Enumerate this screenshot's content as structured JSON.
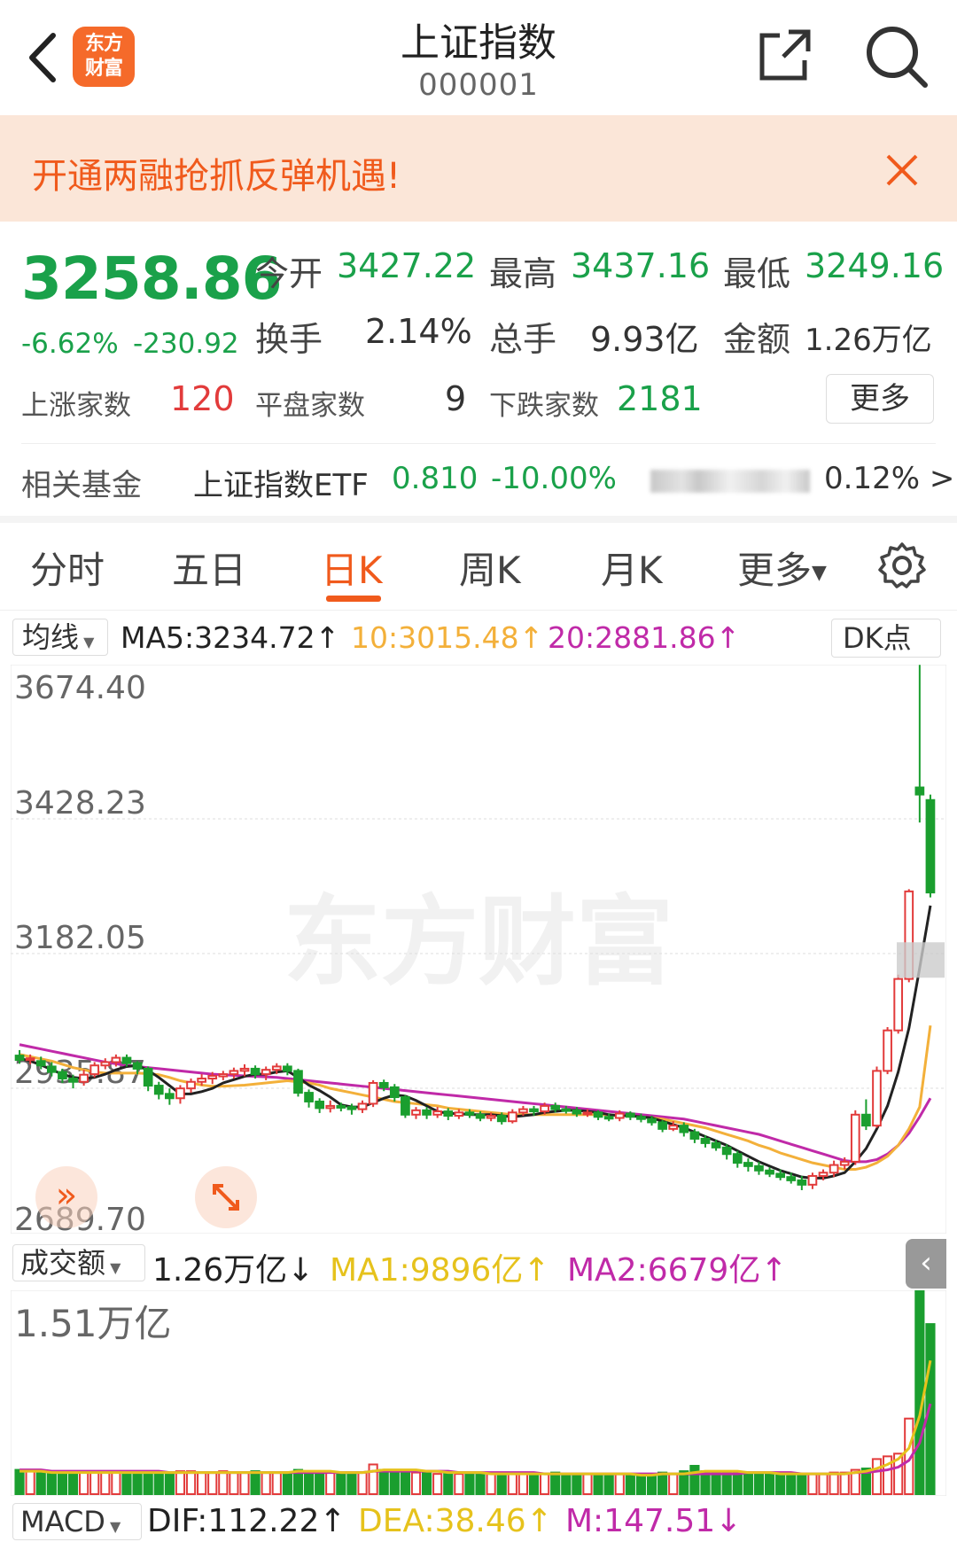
{
  "header": {
    "title": "上证指数",
    "code": "000001",
    "logo_text_line1": "东方",
    "logo_text_line2": "财富"
  },
  "banner": {
    "text": "开通两融抢抓反弹机遇!"
  },
  "quote": {
    "price": "3258.86",
    "change_pct": "-6.62%",
    "change": "-230.92",
    "open_label": "今开",
    "open": "3427.22",
    "high_label": "最高",
    "high": "3437.16",
    "low_label": "最低",
    "low": "3249.16",
    "turnover_label": "换手",
    "turnover": "2.14%",
    "volume_label": "总手",
    "volume": "9.93亿",
    "amount_label": "金额",
    "amount": "1.26万亿",
    "up_label": "上涨家数",
    "up": "120",
    "flat_label": "平盘家数",
    "flat": "9",
    "down_label": "下跌家数",
    "down": "2181",
    "more": "更多"
  },
  "fund": {
    "label": "相关基金",
    "name": "上证指数ETF",
    "price": "0.810",
    "change_pct": "-10.00%",
    "extra": "0.12% >"
  },
  "tabs": [
    "分时",
    "五日",
    "日K",
    "周K",
    "月K",
    "更多"
  ],
  "active_tab": "日K",
  "ma_row": {
    "selector": "均线",
    "ma5": "MA5:3234.72↑",
    "ma10": "10:3015.48↑",
    "ma20": "20:2881.86↑",
    "dk": "DK点"
  },
  "main_chart": {
    "ticks": [
      "3674.40",
      "3428.23",
      "3182.05",
      "2935.87",
      "2689.70"
    ],
    "watermark": "东方财富"
  },
  "volume_row": {
    "selector": "成交额",
    "value": "1.26万亿↓",
    "ma1": "MA1:9896亿↑",
    "ma2": "MA2:6679亿↑"
  },
  "volume_chart": {
    "top_tick": "1.51万亿"
  },
  "macd_row": {
    "selector": "MACD",
    "dif": "DIF:112.22↑",
    "dea": "DEA:38.46↑",
    "m": "M:147.51↓"
  },
  "chart_data": {
    "type": "candlestick",
    "ylim": [
      2689.7,
      3674.4
    ],
    "candles": [
      [
        2960,
        2952,
        2970,
        2945
      ],
      [
        2952,
        2955,
        2962,
        2944
      ],
      [
        2950,
        2942,
        2958,
        2935
      ],
      [
        2940,
        2930,
        2948,
        2922
      ],
      [
        2930,
        2918,
        2936,
        2910
      ],
      [
        2918,
        2912,
        2925,
        2900
      ],
      [
        2912,
        2925,
        2934,
        2905
      ],
      [
        2926,
        2942,
        2948,
        2920
      ],
      [
        2942,
        2948,
        2955,
        2935
      ],
      [
        2948,
        2956,
        2962,
        2940
      ],
      [
        2956,
        2946,
        2962,
        2940
      ],
      [
        2946,
        2936,
        2950,
        2926
      ],
      [
        2936,
        2905,
        2940,
        2895
      ],
      [
        2905,
        2890,
        2912,
        2880
      ],
      [
        2890,
        2882,
        2900,
        2870
      ],
      [
        2882,
        2900,
        2906,
        2872
      ],
      [
        2900,
        2912,
        2918,
        2892
      ],
      [
        2912,
        2918,
        2926,
        2905
      ],
      [
        2918,
        2923,
        2930,
        2908
      ],
      [
        2922,
        2926,
        2932,
        2915
      ],
      [
        2926,
        2932,
        2938,
        2918
      ],
      [
        2932,
        2936,
        2944,
        2922
      ],
      [
        2936,
        2926,
        2942,
        2918
      ],
      [
        2926,
        2934,
        2940,
        2915
      ],
      [
        2934,
        2940,
        2946,
        2926
      ],
      [
        2940,
        2932,
        2946,
        2924
      ],
      [
        2932,
        2892,
        2936,
        2885
      ],
      [
        2892,
        2876,
        2898,
        2865
      ],
      [
        2876,
        2864,
        2882,
        2855
      ],
      [
        2864,
        2868,
        2878,
        2856
      ],
      [
        2868,
        2866,
        2874,
        2858
      ],
      [
        2866,
        2862,
        2872,
        2852
      ],
      [
        2862,
        2872,
        2878,
        2855
      ],
      [
        2872,
        2910,
        2915,
        2866
      ],
      [
        2910,
        2902,
        2916,
        2895
      ],
      [
        2902,
        2884,
        2908,
        2876
      ],
      [
        2884,
        2852,
        2888,
        2846
      ],
      [
        2852,
        2860,
        2866,
        2844
      ],
      [
        2860,
        2852,
        2866,
        2844
      ],
      [
        2852,
        2858,
        2866,
        2846
      ],
      [
        2858,
        2850,
        2864,
        2842
      ],
      [
        2850,
        2856,
        2862,
        2844
      ],
      [
        2856,
        2852,
        2862,
        2846
      ],
      [
        2852,
        2846,
        2858,
        2840
      ],
      [
        2846,
        2850,
        2856,
        2840
      ],
      [
        2850,
        2840,
        2856,
        2834
      ],
      [
        2840,
        2856,
        2862,
        2836
      ],
      [
        2856,
        2862,
        2868,
        2850
      ],
      [
        2862,
        2858,
        2868,
        2850
      ],
      [
        2858,
        2868,
        2874,
        2852
      ],
      [
        2868,
        2862,
        2874,
        2856
      ],
      [
        2862,
        2860,
        2868,
        2854
      ],
      [
        2860,
        2854,
        2866,
        2848
      ],
      [
        2854,
        2856,
        2862,
        2848
      ],
      [
        2856,
        2848,
        2860,
        2842
      ],
      [
        2848,
        2846,
        2854,
        2840
      ],
      [
        2846,
        2854,
        2860,
        2840
      ],
      [
        2854,
        2848,
        2858,
        2842
      ],
      [
        2848,
        2844,
        2854,
        2838
      ],
      [
        2844,
        2838,
        2850,
        2832
      ],
      [
        2838,
        2826,
        2842,
        2820
      ],
      [
        2826,
        2832,
        2840,
        2822
      ],
      [
        2832,
        2820,
        2838,
        2812
      ],
      [
        2820,
        2808,
        2826,
        2800
      ],
      [
        2808,
        2800,
        2814,
        2792
      ],
      [
        2800,
        2792,
        2806,
        2786
      ],
      [
        2792,
        2780,
        2798,
        2770
      ],
      [
        2780,
        2764,
        2786,
        2755
      ],
      [
        2764,
        2758,
        2772,
        2748
      ],
      [
        2758,
        2750,
        2766,
        2742
      ],
      [
        2750,
        2744,
        2756,
        2738
      ],
      [
        2744,
        2738,
        2752,
        2732
      ],
      [
        2738,
        2732,
        2746,
        2726
      ],
      [
        2732,
        2724,
        2740,
        2714
      ],
      [
        2724,
        2740,
        2746,
        2716
      ],
      [
        2740,
        2746,
        2752,
        2732
      ],
      [
        2746,
        2760,
        2768,
        2738
      ],
      [
        2760,
        2766,
        2774,
        2752
      ],
      [
        2766,
        2852,
        2860,
        2760
      ],
      [
        2852,
        2832,
        2880,
        2824
      ],
      [
        2832,
        2932,
        2940,
        2828
      ],
      [
        2932,
        3006,
        3012,
        2926
      ],
      [
        3006,
        3100,
        3108,
        3000
      ],
      [
        3100,
        3260,
        3264,
        3094
      ],
      [
        3450,
        3437,
        3674,
        3386
      ],
      [
        3427,
        3258,
        3437,
        3249
      ]
    ],
    "ma5": [
      2955,
      2950,
      2943,
      2934,
      2926,
      2920,
      2918,
      2920,
      2926,
      2934,
      2940,
      2942,
      2933,
      2920,
      2905,
      2890,
      2890,
      2894,
      2900,
      2910,
      2916,
      2922,
      2926,
      2926,
      2930,
      2932,
      2920,
      2906,
      2896,
      2884,
      2870,
      2866,
      2866,
      2874,
      2882,
      2888,
      2886,
      2878,
      2868,
      2858,
      2854,
      2854,
      2852,
      2852,
      2852,
      2850,
      2848,
      2850,
      2852,
      2856,
      2858,
      2860,
      2860,
      2858,
      2856,
      2852,
      2850,
      2850,
      2848,
      2846,
      2840,
      2834,
      2828,
      2820,
      2812,
      2804,
      2796,
      2786,
      2776,
      2766,
      2758,
      2750,
      2744,
      2738,
      2736,
      2736,
      2740,
      2746,
      2766,
      2790,
      2826,
      2868,
      2930,
      3010,
      3120,
      3234
    ],
    "ma10": [
      2962,
      2958,
      2954,
      2950,
      2944,
      2938,
      2934,
      2930,
      2928,
      2928,
      2928,
      2928,
      2927,
      2925,
      2920,
      2914,
      2910,
      2906,
      2904,
      2904,
      2905,
      2906,
      2908,
      2910,
      2912,
      2914,
      2912,
      2910,
      2906,
      2900,
      2896,
      2892,
      2888,
      2884,
      2880,
      2876,
      2874,
      2872,
      2870,
      2868,
      2864,
      2862,
      2860,
      2858,
      2856,
      2854,
      2852,
      2852,
      2852,
      2852,
      2852,
      2852,
      2852,
      2852,
      2852,
      2852,
      2850,
      2850,
      2848,
      2846,
      2844,
      2840,
      2836,
      2832,
      2828,
      2822,
      2816,
      2810,
      2804,
      2796,
      2790,
      2782,
      2776,
      2770,
      2764,
      2760,
      2756,
      2752,
      2752,
      2756,
      2764,
      2776,
      2796,
      2826,
      2866,
      3015
    ],
    "ma20": [
      2980,
      2976,
      2972,
      2968,
      2964,
      2960,
      2956,
      2952,
      2948,
      2945,
      2942,
      2940,
      2938,
      2936,
      2934,
      2932,
      2930,
      2928,
      2926,
      2925,
      2924,
      2923,
      2922,
      2921,
      2920,
      2918,
      2916,
      2914,
      2912,
      2910,
      2908,
      2906,
      2904,
      2902,
      2900,
      2898,
      2896,
      2894,
      2892,
      2890,
      2888,
      2886,
      2884,
      2882,
      2880,
      2878,
      2876,
      2874,
      2872,
      2870,
      2868,
      2866,
      2864,
      2862,
      2860,
      2858,
      2856,
      2854,
      2852,
      2850,
      2848,
      2846,
      2844,
      2840,
      2836,
      2832,
      2828,
      2824,
      2820,
      2816,
      2810,
      2804,
      2798,
      2792,
      2786,
      2780,
      2774,
      2768,
      2766,
      2766,
      2770,
      2780,
      2796,
      2818,
      2848,
      2882
    ],
    "volume_ylim": [
      0,
      1.51
    ],
    "volume_unit": "万亿",
    "volume": [
      0.18,
      0.17,
      0.17,
      0.16,
      0.15,
      0.15,
      0.16,
      0.16,
      0.17,
      0.17,
      0.16,
      0.16,
      0.17,
      0.16,
      0.16,
      0.17,
      0.17,
      0.16,
      0.16,
      0.17,
      0.16,
      0.16,
      0.17,
      0.16,
      0.16,
      0.16,
      0.18,
      0.17,
      0.16,
      0.16,
      0.15,
      0.16,
      0.16,
      0.22,
      0.18,
      0.17,
      0.18,
      0.16,
      0.16,
      0.15,
      0.16,
      0.15,
      0.16,
      0.15,
      0.15,
      0.16,
      0.15,
      0.16,
      0.15,
      0.15,
      0.16,
      0.15,
      0.15,
      0.15,
      0.15,
      0.14,
      0.15,
      0.14,
      0.14,
      0.15,
      0.16,
      0.15,
      0.17,
      0.21,
      0.17,
      0.17,
      0.16,
      0.16,
      0.15,
      0.15,
      0.15,
      0.14,
      0.14,
      0.14,
      0.15,
      0.15,
      0.16,
      0.16,
      0.18,
      0.19,
      0.26,
      0.28,
      0.3,
      0.56,
      1.51,
      1.26
    ],
    "vol_ma1": [
      0.17,
      0.17,
      0.17,
      0.16,
      0.16,
      0.16,
      0.16,
      0.16,
      0.16,
      0.16,
      0.16,
      0.16,
      0.16,
      0.16,
      0.16,
      0.16,
      0.16,
      0.16,
      0.16,
      0.16,
      0.16,
      0.16,
      0.16,
      0.16,
      0.16,
      0.16,
      0.17,
      0.17,
      0.17,
      0.17,
      0.16,
      0.16,
      0.16,
      0.17,
      0.18,
      0.18,
      0.18,
      0.18,
      0.17,
      0.17,
      0.16,
      0.16,
      0.16,
      0.16,
      0.15,
      0.15,
      0.15,
      0.15,
      0.15,
      0.15,
      0.15,
      0.15,
      0.15,
      0.15,
      0.15,
      0.15,
      0.15,
      0.15,
      0.14,
      0.14,
      0.15,
      0.15,
      0.15,
      0.16,
      0.17,
      0.17,
      0.17,
      0.17,
      0.16,
      0.16,
      0.16,
      0.15,
      0.15,
      0.15,
      0.15,
      0.15,
      0.15,
      0.15,
      0.16,
      0.17,
      0.19,
      0.22,
      0.26,
      0.34,
      0.58,
      0.99
    ],
    "vol_ma2": [
      0.18,
      0.18,
      0.18,
      0.17,
      0.17,
      0.17,
      0.17,
      0.17,
      0.17,
      0.17,
      0.17,
      0.17,
      0.17,
      0.17,
      0.16,
      0.16,
      0.16,
      0.16,
      0.16,
      0.16,
      0.16,
      0.16,
      0.16,
      0.16,
      0.16,
      0.16,
      0.16,
      0.16,
      0.16,
      0.16,
      0.16,
      0.16,
      0.16,
      0.17,
      0.17,
      0.17,
      0.17,
      0.17,
      0.17,
      0.17,
      0.17,
      0.16,
      0.16,
      0.16,
      0.16,
      0.16,
      0.16,
      0.16,
      0.16,
      0.15,
      0.15,
      0.15,
      0.15,
      0.15,
      0.15,
      0.15,
      0.15,
      0.15,
      0.15,
      0.15,
      0.15,
      0.15,
      0.15,
      0.15,
      0.15,
      0.15,
      0.15,
      0.15,
      0.16,
      0.16,
      0.16,
      0.16,
      0.16,
      0.15,
      0.15,
      0.15,
      0.15,
      0.15,
      0.16,
      0.16,
      0.17,
      0.18,
      0.2,
      0.25,
      0.38,
      0.67
    ]
  }
}
